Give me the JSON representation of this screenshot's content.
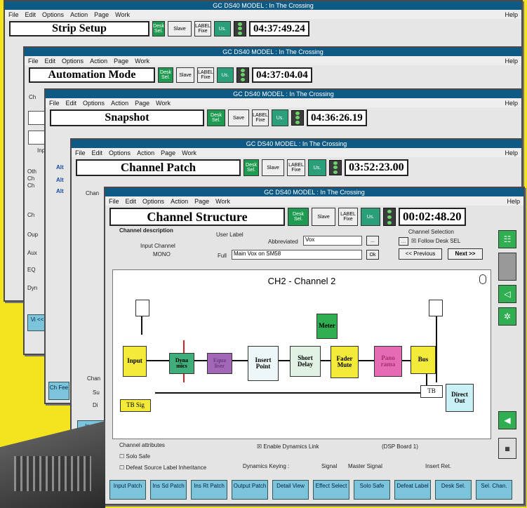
{
  "windows": [
    {
      "title_bar": "GC DS40 MODEL : In The Crossing",
      "menu": [
        "File",
        "Edit",
        "Options",
        "Action",
        "Page",
        "Work"
      ],
      "help": "Help",
      "page_title": "Strip Setup",
      "time": "04:37:49.24",
      "icons": [
        "Desk Sel.",
        "Slave",
        "LABEL Fixe",
        "Us."
      ]
    },
    {
      "title_bar": "GC DS40 MODEL : In The Crossing",
      "menu": [
        "File",
        "Edit",
        "Options",
        "Action",
        "Page",
        "Work"
      ],
      "help": "Help",
      "page_title": "Automation Mode",
      "time": "04:37:04.04",
      "icons": [
        "Desk Sel.",
        "Slave",
        "LABEL Fixe",
        "Us."
      ]
    },
    {
      "title_bar": "GC DS40 MODEL : In The Crossing",
      "menu": [
        "File",
        "Edit",
        "Options",
        "Action",
        "Page",
        "Work"
      ],
      "help": "Help",
      "page_title": "Snapshot",
      "time": "04:36:26.19",
      "icons": [
        "Desk Sel.",
        "Save",
        "LABEL Fixe",
        "Us."
      ]
    },
    {
      "title_bar": "GC DS40 MODEL : In The Crossing",
      "menu": [
        "File",
        "Edit",
        "Options",
        "Action",
        "Page",
        "Work"
      ],
      "help": "Help",
      "page_title": "Channel Patch",
      "time": "03:52:23.00",
      "icons": [
        "Desk Sel.",
        "Slave",
        "LABEL Fixe",
        "Us."
      ]
    },
    {
      "title_bar": "GC DS40 MODEL : In The Crossing",
      "menu": [
        "File",
        "Edit",
        "Options",
        "Action",
        "Page",
        "Work"
      ],
      "help": "Help",
      "page_title": "Channel Structure",
      "time": "00:02:48.20",
      "icons": [
        "Desk Sel.",
        "Slave",
        "LABEL Fixe",
        "Us."
      ]
    }
  ],
  "background_fragments": {
    "w2": [
      "Ch",
      "Inp",
      "Oth",
      "Ch",
      "Ch",
      "Ch",
      "Oup",
      "Aux",
      "EQ",
      "Dyn"
    ],
    "w3": [
      "Alt",
      "Alt",
      "Alt",
      "Go",
      "Stu"
    ],
    "w4": [
      "Chan",
      "Chan",
      "Su",
      "Di"
    ],
    "w3_bottom": "Ch Fee"
  },
  "left_bottom_buttons": [
    "Vi <<",
    "Input Patch"
  ],
  "structure": {
    "channel_description_label": "Channel description",
    "input_channel_label": "Input Channel",
    "input_channel_value": "MONO",
    "user_label": "User Label",
    "abbreviated_label": "Abbreviated",
    "abbreviated_value": "Vox",
    "dots_button": "...",
    "full_label": "Full",
    "full_value": "Main Vox on SM58",
    "ok_button": "Ok",
    "channel_selection_label": "Channel Selection",
    "follow_desk_label": "Follow Desk SEL",
    "previous_button": "<< Previous",
    "next_button": "Next >>",
    "diagram_title": "CH2 - Channel 2",
    "blocks": {
      "input": "Input",
      "dynamics": "Dyna mics",
      "eq": "Equa liser",
      "insert": "Insert Point",
      "delay": "Short Delay",
      "meter": "Meter",
      "fader": "Fader Mute",
      "pan": "Pano rama",
      "bus": "Bus",
      "tb": "TB",
      "direct": "Direct Out",
      "tbsig": "TB Sig"
    },
    "attributes_label": "Channel attributes",
    "solo_safe": "Solo Safe",
    "defeat_label": "Defeat Source Label Inheritance",
    "enable_dynamics": "Enable Dynamics Link",
    "dsp_board": "(DSP Board 1)",
    "dyn_keying_label": "Dynamics Keying :",
    "signal": "Signal",
    "master_signal": "Master Signal",
    "insert_ret": "Insert Ret."
  },
  "bottom_buttons": [
    "Input Patch",
    "Ins Sd Patch",
    "Ins Rt Patch",
    "Output Patch",
    "Detail View",
    "Effect Select",
    "Solo Safe",
    "Defeat Label",
    "Desk Sel.",
    "Sel. Chan."
  ],
  "colors": {
    "background": "#f4e41f",
    "titlebar": "#0f5a84",
    "input_block": "#f3ea3a",
    "dyn_block": "#3fae7a",
    "eq_block": "#a267b6",
    "meter_block": "#2fae52",
    "fader_block": "#f3ea3a",
    "pan_block": "#e46bb4",
    "bus_block": "#f3ea3a",
    "button": "#7cc4dc"
  }
}
